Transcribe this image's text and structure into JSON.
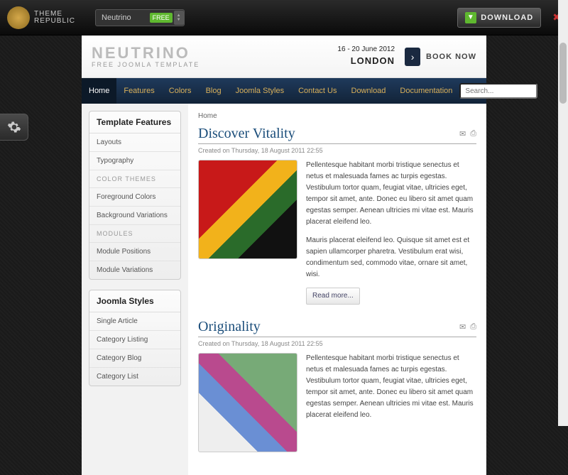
{
  "topbar": {
    "brand1": "THEME",
    "brand2": "REPUBLIC",
    "template": "Neutrino",
    "free_tag": "FREE",
    "download": "DOWNLOAD"
  },
  "header": {
    "title": "NEUTRINO",
    "subtitle": "FREE JOOMLA TEMPLATE",
    "event_dates": "16 - 20 June 2012",
    "event_city": "LONDON",
    "book": "BOOK NOW"
  },
  "nav": {
    "items": [
      "Home",
      "Features",
      "Colors",
      "Blog",
      "Joomla Styles",
      "Contact Us",
      "Download",
      "Documentation"
    ],
    "search_placeholder": "Search..."
  },
  "sidebar": {
    "box1": {
      "title": "Template Features",
      "items": [
        {
          "label": "Layouts",
          "hdr": false
        },
        {
          "label": "Typography",
          "hdr": false
        },
        {
          "label": "COLOR THEMES",
          "hdr": true
        },
        {
          "label": "Foreground Colors",
          "hdr": false
        },
        {
          "label": "Background Variations",
          "hdr": false
        },
        {
          "label": "MODULES",
          "hdr": true
        },
        {
          "label": "Module Positions",
          "hdr": false
        },
        {
          "label": "Module Variations",
          "hdr": false
        }
      ]
    },
    "box2": {
      "title": "Joomla Styles",
      "items": [
        {
          "label": "Single Article",
          "hdr": false
        },
        {
          "label": "Category Listing",
          "hdr": false
        },
        {
          "label": "Category Blog",
          "hdr": false
        },
        {
          "label": "Category List",
          "hdr": false
        }
      ]
    }
  },
  "breadcrumb": "Home",
  "articles": [
    {
      "title": "Discover Vitality",
      "meta": "Created on Thursday, 18 August 2011 22:55",
      "p1": "Pellentesque habitant morbi tristique senectus et netus et malesuada fames ac turpis egestas. Vestibulum tortor quam, feugiat vitae, ultricies eget, tempor sit amet, ante. Donec eu libero sit amet quam egestas semper. Aenean ultricies mi vitae est. Mauris placerat eleifend leo.",
      "p2": "Mauris placerat eleifend leo. Quisque sit amet est et sapien ullamcorper pharetra. Vestibulum erat wisi, condimentum sed, commodo vitae, ornare sit amet, wisi.",
      "readmore": "Read more..."
    },
    {
      "title": "Originality",
      "meta": "Created on Thursday, 18 August 2011 22:55",
      "p1": "Pellentesque habitant morbi tristique senectus et netus et malesuada fames ac turpis egestas. Vestibulum tortor quam, feugiat vitae, ultricies eget, tempor sit amet, ante. Donec eu libero sit amet quam egestas semper. Aenean ultricies mi vitae est. Mauris placerat eleifend leo."
    }
  ]
}
